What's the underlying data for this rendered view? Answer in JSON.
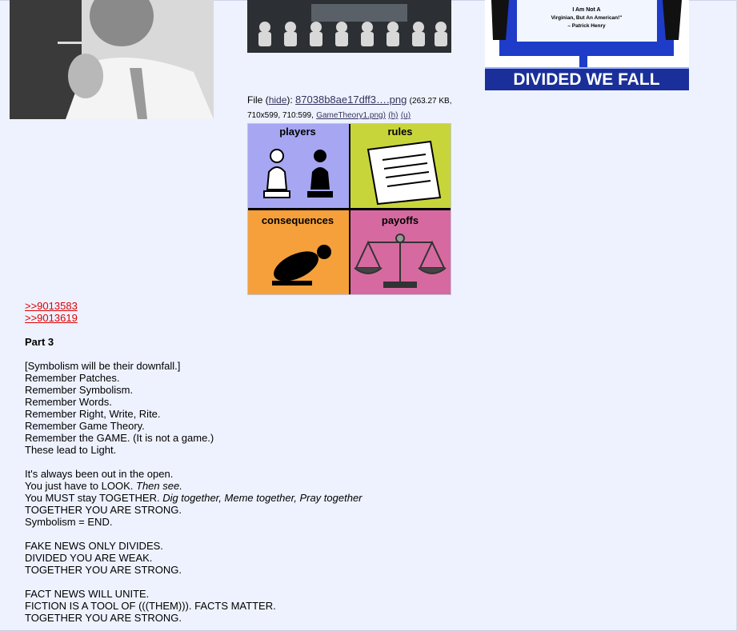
{
  "images": {
    "top_left_alt": "",
    "chess_alt": "",
    "divided_poster": {
      "quote_line1": "I Am Not A",
      "quote_line2": "Virginian, But An American!\"",
      "quote_attribution": "– Patrick Henry",
      "banner": "DIVIDED WE FALL"
    },
    "game_theory": {
      "players": "players",
      "rules": "rules",
      "consequences": "consequences",
      "payoffs": "payoffs"
    }
  },
  "file_info": {
    "label": "File",
    "hide": "hide",
    "filename": "87038b8ae17dff3….png",
    "size": "(263.27 KB,",
    "dims": "710x599, 710:599,",
    "original_name": "GameTheory1.png)",
    "h": "(h)",
    "u": "(u)"
  },
  "post": {
    "quote1": ">>9013583",
    "quote2": ">>9013619",
    "heading": "Part 3",
    "lines_a": [
      "[Symbolism will be their downfall.]",
      "Remember Patches.",
      "Remember Symbolism.",
      "Remember Words.",
      "Remember Right, Write, Rite.",
      "Remember Game Theory.",
      "Remember the GAME. (It is not a game.)",
      "These lead to Light."
    ],
    "open": "It's always been out in the open.",
    "look": "You just have to LOOK. ",
    "look_italic": "Then see.",
    "must": "You MUST stay TOGETHER. ",
    "must_italic": "Dig together, Meme together, Pray together",
    "strong1": "TOGETHER YOU ARE STRONG.",
    "symbolism_end": "Symbolism = END.",
    "fake": "FAKE NEWS ONLY DIVIDES.",
    "weak": "DIVIDED YOU ARE WEAK.",
    "strong2": "TOGETHER YOU ARE STRONG.",
    "fact": "FACT NEWS WILL UNITE.",
    "fiction": "FICTION IS A TOOL OF (((THEM))). FACTS MATTER.",
    "strong3": "TOGETHER YOU ARE STRONG."
  }
}
